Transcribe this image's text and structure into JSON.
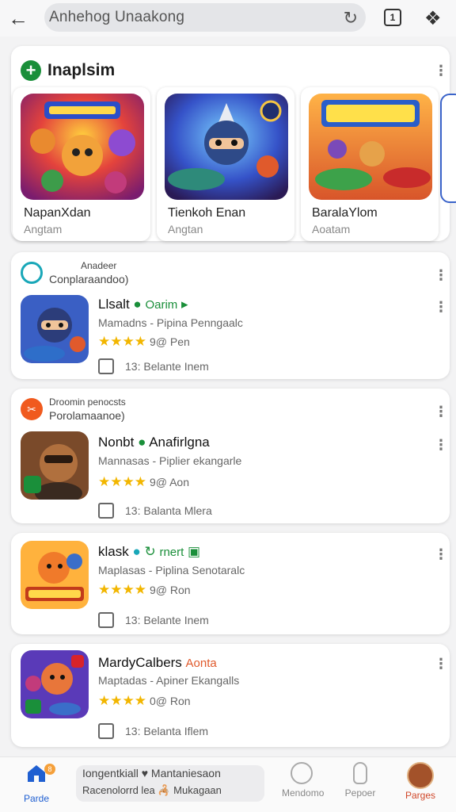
{
  "browser": {
    "address": "Anhehog Unaakong",
    "tabs_count": "1"
  },
  "featured": {
    "title": "Inaplsim",
    "tiles": [
      {
        "name": "NapanXdan",
        "sub": "Angtam"
      },
      {
        "name": "Tienkoh Enan",
        "sub": "Angtan"
      },
      {
        "name": "BaralaYlom",
        "sub": "Aoatam"
      }
    ]
  },
  "sections": [
    {
      "category_title": "Anadeer",
      "category_sub": "Conplaraandoo)",
      "app_name": "Llsalt",
      "app_tag": "Oarim",
      "developer": "Mamadns - Pipina Penngaalc",
      "rating": "9@ Pen",
      "extra": "13: Belante Inem"
    },
    {
      "category_title": "Droomin penocsts",
      "category_sub": "Porolamaanoe)",
      "app_name": "Nonbt",
      "app_tag": "Anafirlgna",
      "developer": "Mannasas - Piplier ekangarle",
      "rating": "9@ Aon",
      "extra": "13: Balanta Mlera"
    },
    {
      "category_title": "",
      "category_sub": "",
      "app_name": "klask",
      "app_tag": "rnert",
      "developer": "Maplasas - Piplina Senotaralc",
      "rating": "9@ Ron",
      "extra": "13: Belante Inem"
    },
    {
      "category_title": "",
      "category_sub": "",
      "app_name": "MardyCalbers",
      "app_tag": "Aonta",
      "developer": "Maptadas - Apiner Ekangalls",
      "rating": "0@ Ron",
      "extra": "13: Belanta Iflem"
    }
  ],
  "bottom_nav": {
    "home_label": "Parde",
    "badge": "8",
    "center_line1": "Iongentkiall ♥ Mantaniesaon",
    "center_line2": "Racenolorrd lea 🦂 Mukagaan",
    "item3_label": "Mendomo",
    "item4_label": "Pepoer",
    "item5_label": "Parges"
  },
  "colors": {
    "accent_green": "#1a8f3a",
    "accent_teal": "#19a7b8",
    "accent_orange": "#f05a1e",
    "star": "#f2b600"
  }
}
